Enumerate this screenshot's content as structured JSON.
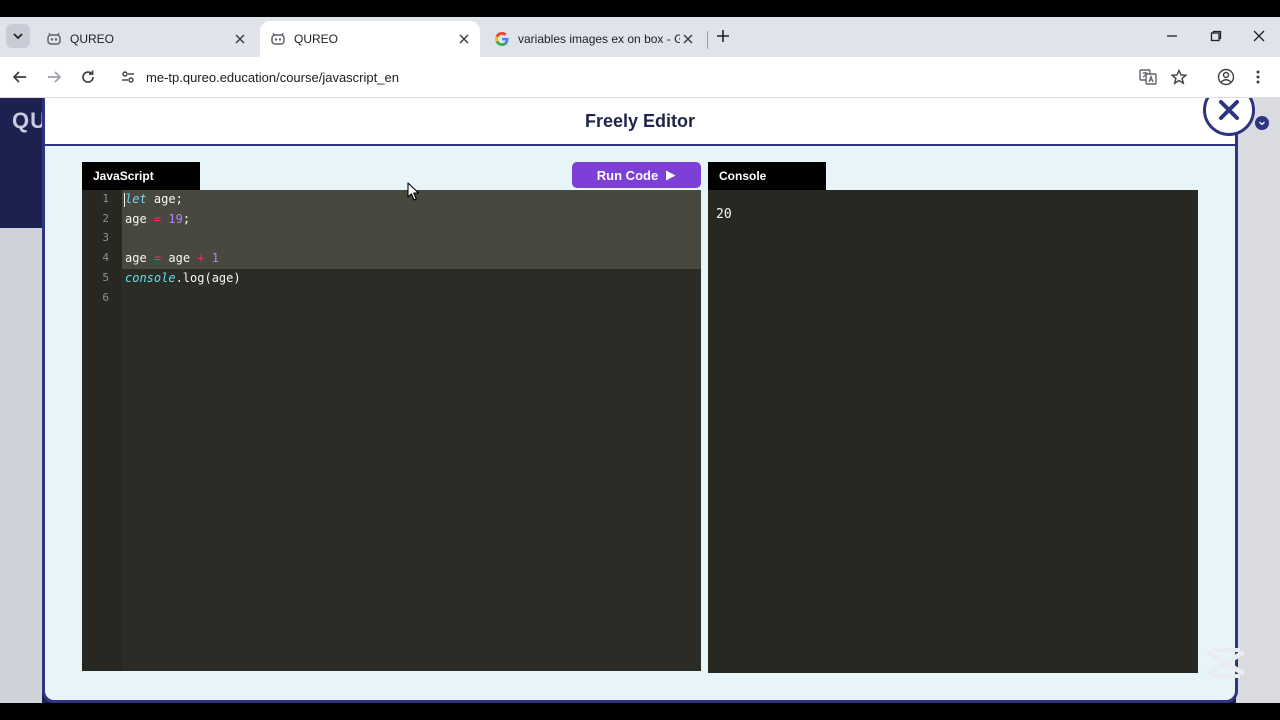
{
  "browser": {
    "tabs": [
      {
        "title": "QUREO",
        "active": false
      },
      {
        "title": "QUREO",
        "active": true
      },
      {
        "title": "variables images ex on box - Google",
        "active": false
      }
    ],
    "url": "me-tp.qureo.education/course/javascript_en"
  },
  "page": {
    "logo_text": "QU"
  },
  "modal": {
    "title": "Freely Editor",
    "editor_tab": "JavaScript",
    "console_tab": "Console",
    "run_label": "Run Code",
    "run_icon": "play-icon"
  },
  "editor": {
    "line_numbers": [
      "1",
      "2",
      "3",
      "4",
      "5",
      "6"
    ],
    "lines": [
      [
        {
          "t": "let",
          "c": "kw"
        },
        {
          "t": " age;",
          "c": ""
        }
      ],
      [
        {
          "t": "age ",
          "c": ""
        },
        {
          "t": "=",
          "c": "op"
        },
        {
          "t": " ",
          "c": ""
        },
        {
          "t": "19",
          "c": "num"
        },
        {
          "t": ";",
          "c": ""
        }
      ],
      [],
      [
        {
          "t": "age ",
          "c": ""
        },
        {
          "t": "=",
          "c": "op"
        },
        {
          "t": " age ",
          "c": ""
        },
        {
          "t": "+",
          "c": "op"
        },
        {
          "t": " ",
          "c": ""
        },
        {
          "t": "1",
          "c": "num"
        }
      ],
      [
        {
          "t": "console",
          "c": "fn"
        },
        {
          "t": ".log(age)",
          "c": ""
        }
      ],
      []
    ]
  },
  "console": {
    "output": "20"
  },
  "colors": {
    "accent": "#7d3fd6",
    "modal_border": "#2d3480",
    "editor_bg": "#2b2c26"
  }
}
